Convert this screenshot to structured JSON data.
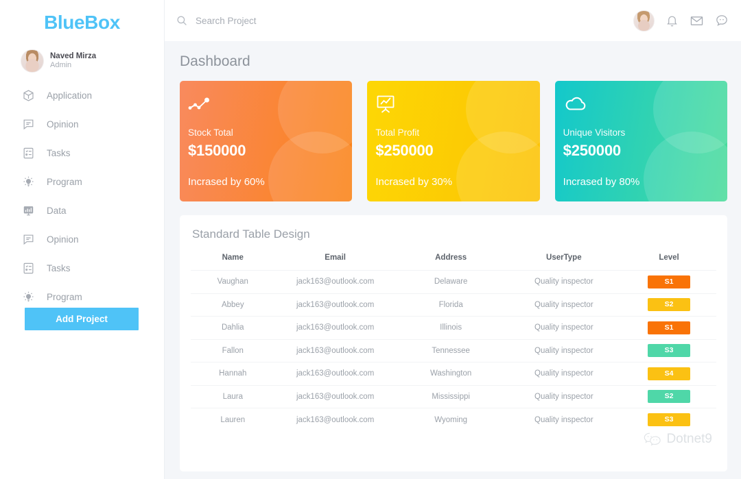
{
  "brand": {
    "logo_text": "BlueBox",
    "logo_color": "#4FC3F7"
  },
  "sidebar": {
    "profile": {
      "name": "Naved Mirza",
      "role": "Admin",
      "avatar": "user-photo"
    },
    "items": [
      {
        "label": "Application",
        "icon": "cube-icon"
      },
      {
        "label": "Opinion",
        "icon": "comment-icon"
      },
      {
        "label": "Tasks",
        "icon": "checklist-icon"
      },
      {
        "label": "Program",
        "icon": "lightbulb-icon"
      },
      {
        "label": "Data",
        "icon": "bar-chart-monitor-icon"
      },
      {
        "label": "Opinion",
        "icon": "comment-icon"
      },
      {
        "label": "Tasks",
        "icon": "checklist-icon"
      },
      {
        "label": "Program",
        "icon": "lightbulb-icon"
      }
    ],
    "add_project_label": "Add Project"
  },
  "topbar": {
    "search_placeholder": "Search Project",
    "search_value": "",
    "search_icon": "search-icon",
    "icons": [
      "user-avatar",
      "bell-icon",
      "envelope-icon",
      "chat-bubble-icon"
    ]
  },
  "page": {
    "title": "Dashboard"
  },
  "cards": [
    {
      "label": "Stock Total",
      "value": "$150000",
      "delta": "Incrased by 60%",
      "icon": "line-chart-icon",
      "color_from": "#F98A5E",
      "color_to": "#FA8215"
    },
    {
      "label": "Total Profit",
      "value": "$250000",
      "delta": "Incrased by 30%",
      "icon": "presentation-chart-icon",
      "color_from": "#FDD705",
      "color_to": "#FCC203"
    },
    {
      "label": "Unique Visitors",
      "value": "$250000",
      "delta": "Incrased by 80%",
      "icon": "cloud-icon",
      "color_from": "#13C8CB",
      "color_to": "#4BDC9B"
    }
  ],
  "table": {
    "title": "Standard Table Design",
    "columns": [
      "Name",
      "Email",
      "Address",
      "UserType",
      "Level"
    ],
    "rows": [
      {
        "name": "Vaughan",
        "email": "jack163@outlook.com",
        "address": "Delaware",
        "usertype": "Quality inspector",
        "level": "S1",
        "level_color": "#F97307"
      },
      {
        "name": "Abbey",
        "email": "jack163@outlook.com",
        "address": "Florida",
        "usertype": "Quality inspector",
        "level": "S2",
        "level_color": "#FBC113"
      },
      {
        "name": "Dahlia",
        "email": "jack163@outlook.com",
        "address": "Illinois",
        "usertype": "Quality inspector",
        "level": "S1",
        "level_color": "#F97307"
      },
      {
        "name": "Fallon",
        "email": "jack163@outlook.com",
        "address": "Tennessee",
        "usertype": "Quality inspector",
        "level": "S3",
        "level_color": "#4FD7A8"
      },
      {
        "name": "Hannah",
        "email": "jack163@outlook.com",
        "address": "Washington",
        "usertype": "Quality inspector",
        "level": "S4",
        "level_color": "#FBC113"
      },
      {
        "name": "Laura",
        "email": "jack163@outlook.com",
        "address": "Mississippi",
        "usertype": "Quality inspector",
        "level": "S2",
        "level_color": "#4FD7A8"
      },
      {
        "name": "Lauren",
        "email": "jack163@outlook.com",
        "address": "Wyoming",
        "usertype": "Quality inspector",
        "level": "S3",
        "level_color": "#FBC113"
      }
    ]
  },
  "watermark": {
    "text": "Dotnet9",
    "icon": "wechat-icon"
  }
}
